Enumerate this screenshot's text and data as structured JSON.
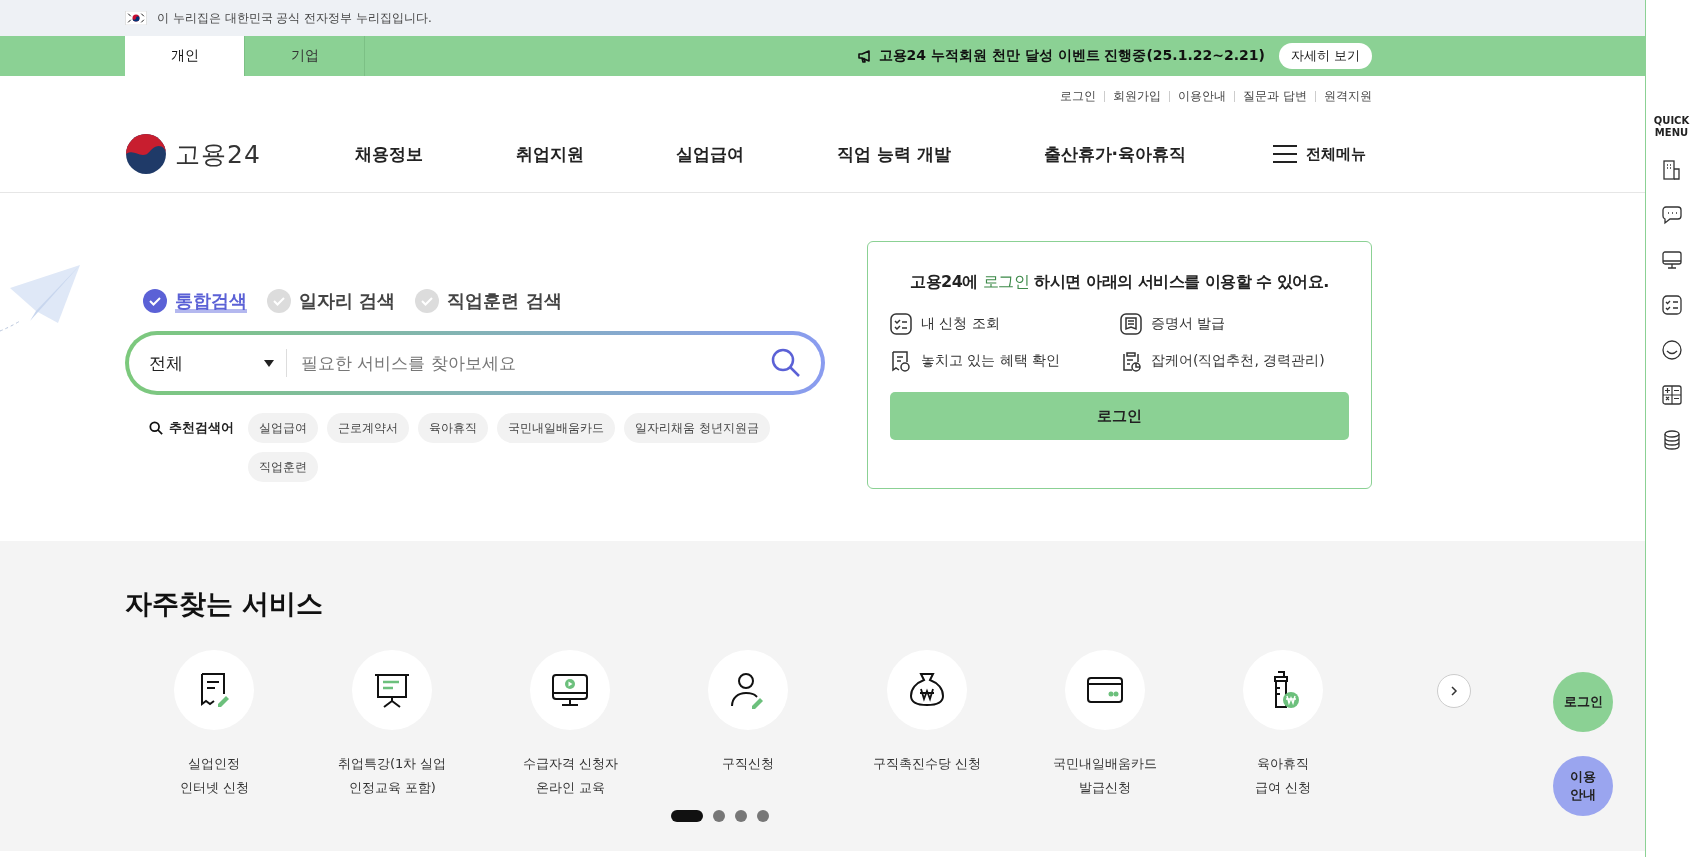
{
  "gov_banner": {
    "text": "이 누리집은 대한민국 공식 전자정부 누리집입니다."
  },
  "audience_tabs": [
    {
      "label": "개인",
      "selected": true
    },
    {
      "label": "기업",
      "selected": false
    }
  ],
  "notice": {
    "text": "고용24 누적회원 천만 달성 이벤트 진행중(25.1.22~2.21)",
    "button": "자세히 보기"
  },
  "util_links": [
    "로그인",
    "회원가입",
    "이용안내",
    "질문과 답변",
    "원격지원"
  ],
  "logo": {
    "text": "고용24"
  },
  "nav": [
    "채용정보",
    "취업지원",
    "실업급여",
    "직업 능력 개발",
    "출산휴가·육아휴직"
  ],
  "all_menu": "전체메뉴",
  "search_tabs": [
    {
      "label": "통합검색",
      "selected": true
    },
    {
      "label": "일자리 검색",
      "selected": false
    },
    {
      "label": "직업훈련 검색",
      "selected": false
    }
  ],
  "search": {
    "category": "전체",
    "placeholder": "필요한 서비스를 찾아보세요"
  },
  "recommended": {
    "label": "추천검색어",
    "keywords": [
      "실업급여",
      "근로계약서",
      "육아휴직",
      "국민내일배움카드",
      "일자리채움 청년지원금",
      "직업훈련"
    ]
  },
  "login_box": {
    "title": "고용24에 **로그인** 하시면 아래의 서비스를 이용할 수 있어요.",
    "services": [
      {
        "kind": "checklist",
        "label": "내 신청 조회"
      },
      {
        "kind": "certificate",
        "label": "증명서 발급"
      },
      {
        "kind": "receipt",
        "label": "놓치고 있는 혜택 확인"
      },
      {
        "kind": "clipboard",
        "label": "잡케어(직업추천, 경력관리)"
      }
    ],
    "button": "로그인"
  },
  "frequent": {
    "title": "자주찾는 서비스",
    "items": [
      {
        "kind": "document",
        "lines": [
          "실업인정",
          "인터넷 신청"
        ]
      },
      {
        "kind": "presentation",
        "lines": [
          "취업특강(1차 실업",
          "인정교육 포함)"
        ]
      },
      {
        "kind": "monitor",
        "lines": [
          "수급자격 신청자",
          "온라인 교육"
        ]
      },
      {
        "kind": "person",
        "lines": [
          "구직신청"
        ]
      },
      {
        "kind": "moneybag",
        "lines": [
          "구직촉진수당 신청"
        ]
      },
      {
        "kind": "card",
        "lines": [
          "국민내일배움카드",
          "발급신청"
        ]
      },
      {
        "kind": "bottle",
        "lines": [
          "육아휴직",
          "급여 신청"
        ]
      }
    ],
    "pages": [
      {
        "selected": true
      },
      {
        "selected": false
      },
      {
        "selected": false
      },
      {
        "selected": false
      }
    ]
  },
  "floating": [
    {
      "kind": "login",
      "label": "로그인"
    },
    {
      "kind": "guide",
      "label": "이용\n안내"
    }
  ],
  "quick_menu": {
    "title": "QUICK\nMENU",
    "items": [
      {
        "kind": "building"
      },
      {
        "kind": "chat"
      },
      {
        "kind": "monitor"
      },
      {
        "kind": "checklist"
      },
      {
        "kind": "smile"
      },
      {
        "kind": "calculator"
      },
      {
        "kind": "database"
      }
    ]
  }
}
